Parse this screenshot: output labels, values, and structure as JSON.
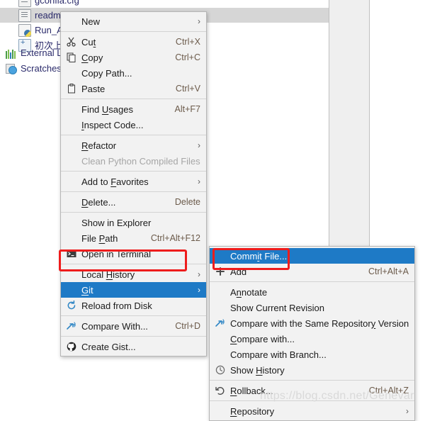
{
  "project_tree": {
    "items": [
      {
        "label": "gconfia.cfg",
        "icon": "file-icon",
        "selected": false,
        "clipped": true
      },
      {
        "label": "readme",
        "icon": "file-icon",
        "selected": true,
        "clipped": false
      },
      {
        "label": "Run_A",
        "icon": "python-file-icon",
        "selected": false,
        "clipped": false
      },
      {
        "label": "初次上",
        "icon": "upload-file-icon",
        "selected": false,
        "clipped": false
      },
      {
        "label": "External L",
        "icon": "external-libraries-icon",
        "selected": false,
        "clipped": false
      },
      {
        "label": "Scratches",
        "icon": "scratches-icon",
        "selected": false,
        "clipped": false
      }
    ]
  },
  "context_menu": {
    "items": [
      {
        "label": "New",
        "accel": "",
        "icon": "",
        "arrow": "›",
        "type": "item"
      },
      {
        "type": "separator"
      },
      {
        "label": "Cut",
        "accel": "Ctrl+X",
        "icon": "scissors-icon",
        "arrow": "",
        "type": "item"
      },
      {
        "label": "Copy",
        "accel": "Ctrl+C",
        "icon": "copy-icon",
        "arrow": "",
        "type": "item"
      },
      {
        "label": "Copy Path...",
        "accel": "",
        "icon": "",
        "arrow": "",
        "type": "item"
      },
      {
        "label": "Paste",
        "accel": "Ctrl+V",
        "icon": "clipboard-icon",
        "arrow": "",
        "type": "item"
      },
      {
        "type": "separator"
      },
      {
        "label": "Find Usages",
        "accel": "Alt+F7",
        "icon": "",
        "arrow": "",
        "type": "item"
      },
      {
        "label": "Inspect Code...",
        "accel": "",
        "icon": "",
        "arrow": "",
        "type": "item"
      },
      {
        "type": "separator"
      },
      {
        "label": "Refactor",
        "accel": "",
        "icon": "",
        "arrow": "›",
        "type": "item"
      },
      {
        "label": "Clean Python Compiled Files",
        "accel": "",
        "icon": "",
        "arrow": "",
        "type": "item",
        "disabled": true
      },
      {
        "type": "separator"
      },
      {
        "label": "Add to Favorites",
        "accel": "",
        "icon": "",
        "arrow": "›",
        "type": "item"
      },
      {
        "type": "separator"
      },
      {
        "label": "Delete...",
        "accel": "Delete",
        "icon": "",
        "arrow": "",
        "type": "item"
      },
      {
        "type": "separator"
      },
      {
        "label": "Show in Explorer",
        "accel": "",
        "icon": "",
        "arrow": "",
        "type": "item"
      },
      {
        "label": "File Path",
        "accel": "Ctrl+Alt+F12",
        "icon": "",
        "arrow": "",
        "type": "item"
      },
      {
        "label": "Open in Terminal",
        "accel": "",
        "icon": "terminal-icon",
        "arrow": "",
        "type": "item"
      },
      {
        "type": "separator"
      },
      {
        "label": "Local History",
        "accel": "",
        "icon": "",
        "arrow": "›",
        "type": "item"
      },
      {
        "label": "Git",
        "accel": "",
        "icon": "",
        "arrow": "›",
        "type": "item",
        "highlighted": true
      },
      {
        "label": "Reload from Disk",
        "accel": "",
        "icon": "reload-icon",
        "arrow": "",
        "type": "item"
      },
      {
        "type": "separator"
      },
      {
        "label": "Compare With...",
        "accel": "Ctrl+D",
        "icon": "compare-icon",
        "arrow": "",
        "type": "item"
      },
      {
        "type": "separator"
      },
      {
        "label": "Create Gist...",
        "accel": "",
        "icon": "github-icon",
        "arrow": "",
        "type": "item"
      }
    ]
  },
  "git_submenu": {
    "items": [
      {
        "label": "Commit File...",
        "accel": "",
        "icon": "",
        "arrow": "",
        "type": "item",
        "highlighted": true
      },
      {
        "label": "Add",
        "accel": "Ctrl+Alt+A",
        "icon": "plus-icon",
        "arrow": "",
        "type": "item"
      },
      {
        "type": "separator"
      },
      {
        "label": "Annotate",
        "accel": "",
        "icon": "",
        "arrow": "",
        "type": "item"
      },
      {
        "label": "Show Current Revision",
        "accel": "",
        "icon": "",
        "arrow": "",
        "type": "item"
      },
      {
        "label": "Compare with the Same Repository Version",
        "accel": "",
        "icon": "compare-icon",
        "arrow": "",
        "type": "item"
      },
      {
        "label": "Compare with...",
        "accel": "",
        "icon": "",
        "arrow": "",
        "type": "item"
      },
      {
        "label": "Compare with Branch...",
        "accel": "",
        "icon": "",
        "arrow": "",
        "type": "item"
      },
      {
        "label": "Show History",
        "accel": "",
        "icon": "clock-icon",
        "arrow": "",
        "type": "item"
      },
      {
        "type": "separator"
      },
      {
        "label": "Rollback...",
        "accel": "Ctrl+Alt+Z",
        "icon": "rollback-icon",
        "arrow": "",
        "type": "item"
      },
      {
        "type": "separator"
      },
      {
        "label": "Repository",
        "accel": "",
        "icon": "",
        "arrow": "›",
        "type": "item"
      }
    ]
  },
  "annotations": {
    "git_highlight_box_color": "#ee1c1c",
    "commit_highlight_box_color": "#ee1c1c",
    "selection_color": "#1e7ac6"
  },
  "watermark": {
    "text": "https://blog.csdn.net/Genevar"
  }
}
